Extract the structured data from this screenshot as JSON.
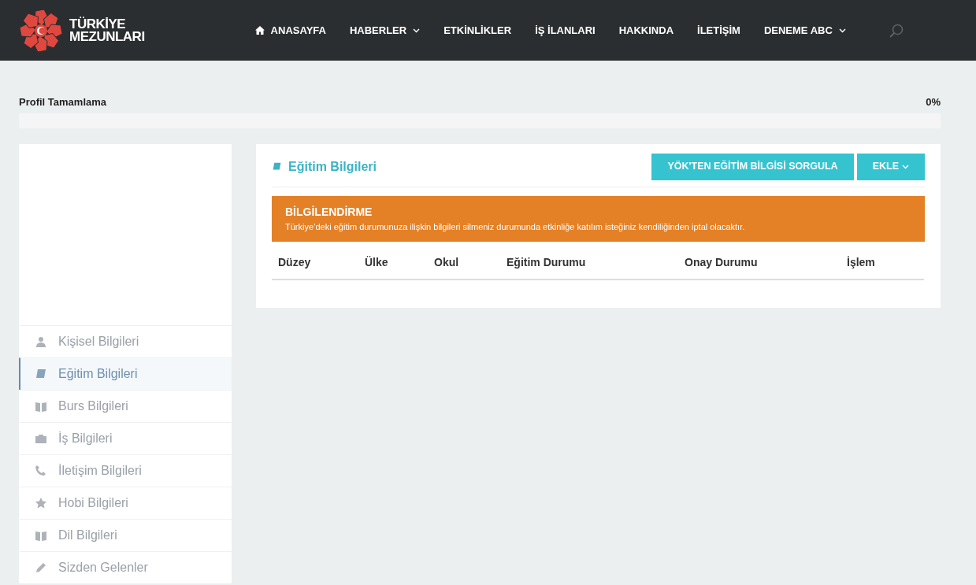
{
  "brand": {
    "line_1": "TÜRKİYE",
    "line_2": "MEZUNLARI"
  },
  "nav": [
    {
      "label": "ANASAYFA",
      "dropdown": false
    },
    {
      "label": "HABERLER",
      "dropdown": true
    },
    {
      "label": "ETKİNLİKLER",
      "dropdown": false
    },
    {
      "label": "İŞ İLANLARI",
      "dropdown": false
    },
    {
      "label": "HAKKINDA",
      "dropdown": false
    },
    {
      "label": "İLETİŞİM",
      "dropdown": false
    },
    {
      "label": "DENEME ABC",
      "dropdown": true
    }
  ],
  "profile_completion": {
    "label": "Profil Tamamlama",
    "reading": "0%",
    "level": 0
  },
  "sidebar": {
    "items": [
      {
        "label": "Kişisel Bilgileri",
        "selected": false
      },
      {
        "label": "Eğitim Bilgileri",
        "selected": true
      },
      {
        "label": "Burs Bilgileri",
        "selected": false
      },
      {
        "label": "İş Bilgileri",
        "selected": false
      },
      {
        "label": "İletişim Bilgileri",
        "selected": false
      },
      {
        "label": "Hobi Bilgileri",
        "selected": false
      },
      {
        "label": "Dil Bilgileri",
        "selected": false
      },
      {
        "label": "Sizden Gelenler",
        "selected": false
      }
    ]
  },
  "panel": {
    "title": "Eğitim Bilgileri",
    "buttons": [
      {
        "label": "YÖK'TEN EĞİTİM BİLGİSİ SORGULA",
        "dropdown": false
      },
      {
        "label": "EKLE",
        "dropdown": true
      }
    ],
    "notice": {
      "title": "BİLGİLENDİRME",
      "text": "Türkiye’deki eğitim durumunuza ilişkin bilgileri silmeniz durumunda etkinliğe katılım isteğiniz kendiliğinden iptal olacaktır."
    },
    "table": {
      "columns": [
        "Düzey",
        "Ülke",
        "Okul",
        "Eğitim Durumu",
        "Onay Durumu",
        "İşlem"
      ]
    }
  }
}
